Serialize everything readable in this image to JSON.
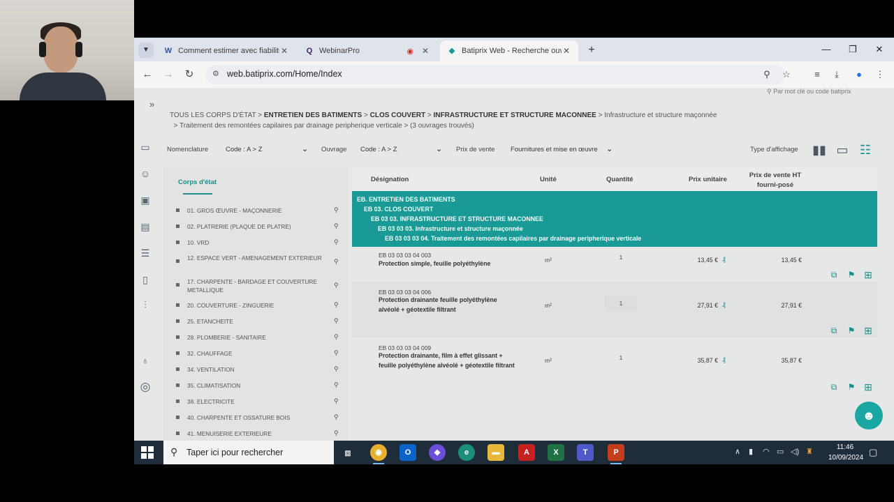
{
  "browser": {
    "tabs": [
      {
        "title": "Comment estimer avec fiabilité",
        "favicon": "W",
        "color": "#2b579a"
      },
      {
        "title": "WebinarPro",
        "favicon": "Q",
        "color": "#3a2a6b"
      },
      {
        "title": "Batiprix Web - Recherche ouvra",
        "favicon": "◆",
        "color": "#1a9a96"
      }
    ],
    "url": "web.batiprix.com/Home/Index"
  },
  "page": {
    "search_hint": "Par mot clé ou code batiprix",
    "breadcrumb": {
      "c1": "TOUS LES CORPS D'ÉTAT",
      "c2": "ENTRETIEN DES BATIMENTS",
      "c3": "CLOS COUVERT",
      "c4": "INFRASTRUCTURE ET STRUCTURE MACONNEE",
      "c5": "Infrastructure et structure maçonnée",
      "c6": "Traitement des remontées capilaires par drainage peripherique verticale",
      "count": "(3 ouvrages trouvés)"
    },
    "filters": {
      "nomenclature_label": "Nomenclature",
      "nomenclature_value": "Code : A > Z",
      "ouvrage_label": "Ouvrage",
      "ouvrage_value": "Code : A > Z",
      "prix_label": "Prix de vente",
      "prix_value": "Fournitures et mise en œuvre",
      "display_label": "Type d'affichage"
    },
    "sidebar": {
      "title": "Corps d'état",
      "items": [
        "01. GROS ŒUVRE - MAÇONNERIE",
        "02. PLATRERIE (PLAQUE DE PLATRE)",
        "10. VRD",
        "12. ESPACE VERT - AMENAGEMENT EXTERIEUR",
        "17. CHARPENTE - BARDAGE ET COUVERTURE METALLIQUE",
        "20. COUVERTURE - ZINGUERIE",
        "25. ETANCHEITE",
        "28. PLOMBERIE - SANITAIRE",
        "32. CHAUFFAGE",
        "34. VENTILATION",
        "35. CLIMATISATION",
        "38. ELECTRICITE",
        "40. CHARPENTE ET OSSATURE BOIS",
        "41. MENUISERIE EXTERIEURE"
      ]
    },
    "table": {
      "headers": {
        "designation": "Désignation",
        "unite": "Unité",
        "quantite": "Quantité",
        "prix_unitaire": "Prix unitaire",
        "prix_vente_1": "Prix de vente HT",
        "prix_vente_2": "fourni-posé"
      },
      "tree": [
        "EB. ENTRETIEN DES BATIMENTS",
        "EB 03. CLOS COUVERT",
        "EB 03 03. INFRASTRUCTURE ET STRUCTURE MACONNEE",
        "EB 03 03 03. Infrastructure et structure maçonnée",
        "EB 03 03 03 04. Traitement des remontées capilaires par drainage peripherique verticale"
      ],
      "rows": [
        {
          "code": "EB 03 03 03 04 003",
          "name": "Protection simple, feuille polyéthylène",
          "unit": "m²",
          "qty": "1",
          "price": "13,45 €",
          "pv": "13,45 €"
        },
        {
          "code": "EB 03 03 03 04 006",
          "name": "Protection drainante feuille polyéthylène alvéolé + géotextile filtrant",
          "unit": "m²",
          "qty": "1",
          "price": "27,91 €",
          "pv": "27,91 €"
        },
        {
          "code": "EB 03 03 03 04 009",
          "name": "Protection drainante, film à effet glissant + feuille polyéthylène alvéolé + géotextile filtrant",
          "unit": "m²",
          "qty": "1",
          "price": "35,87 €",
          "pv": "35,87 €"
        }
      ]
    }
  },
  "taskbar": {
    "search_placeholder": "Taper ici pour rechercher",
    "time": "11:46",
    "date": "10/09/2024"
  },
  "colors": {
    "accent": "#1a9a96"
  }
}
